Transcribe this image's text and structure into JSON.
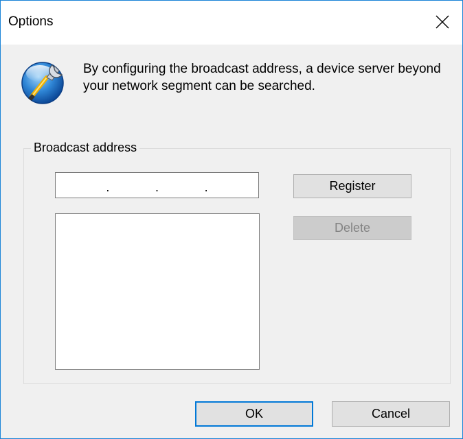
{
  "window": {
    "title": "Options"
  },
  "message": "By configuring the broadcast address, a device server beyond your network segment can be searched.",
  "group": {
    "label": "Broadcast address",
    "ip_address": {
      "dots": [
        ".",
        ".",
        "."
      ]
    },
    "list_items": []
  },
  "buttons": {
    "register": "Register",
    "delete": "Delete",
    "ok": "OK",
    "cancel": "Cancel"
  },
  "icons": {
    "close": "close-icon",
    "app": "settings-wrench-icon"
  },
  "colors": {
    "accent": "#0078d7",
    "window_border": "#1883d7",
    "dialog_bg": "#f0f0f0"
  }
}
